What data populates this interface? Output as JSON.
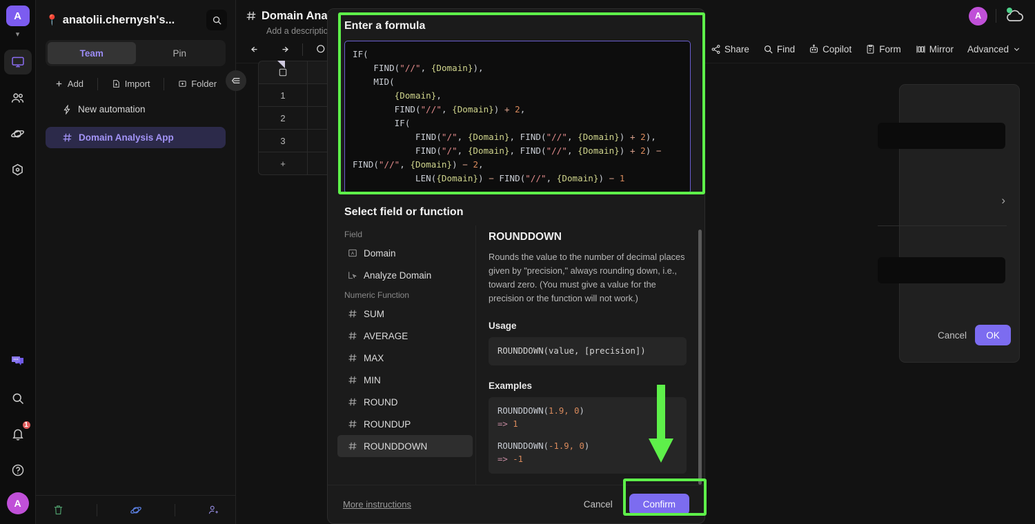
{
  "rail": {
    "logo": "A",
    "avatar": "A",
    "items": [
      {
        "name": "monitor-icon",
        "label": "Workspace"
      },
      {
        "name": "people-icon",
        "label": "Members"
      },
      {
        "name": "planet-icon",
        "label": "Explore"
      },
      {
        "name": "hexagon-icon",
        "label": "Automations"
      },
      {
        "name": "chat-icon",
        "label": "Messages"
      },
      {
        "name": "search-icon",
        "label": "Search"
      },
      {
        "name": "bell-icon",
        "label": "Notifications"
      },
      {
        "name": "help-icon",
        "label": "Help"
      }
    ],
    "notification_count": "1"
  },
  "sidebar": {
    "title": "anatolii.chernysh's...",
    "pin_emoji": "📍",
    "tabs": [
      {
        "label": "Team",
        "active": true
      },
      {
        "label": "Pin",
        "active": false
      }
    ],
    "actions": [
      {
        "label": "Add",
        "icon": "plus-icon"
      },
      {
        "label": "Import",
        "icon": "import-icon"
      },
      {
        "label": "Folder",
        "icon": "folder-plus-icon"
      }
    ],
    "new_automation": "New automation",
    "app_item": "Domain Analysis App",
    "bottom_icons": [
      "trash-icon",
      "planet-icon",
      "add-user-icon"
    ]
  },
  "main": {
    "title": "Domain Analy",
    "description": "Add a description",
    "avatar": "A",
    "toolbar": [
      {
        "label": "Share",
        "icon": "share-icon"
      },
      {
        "label": "Find",
        "icon": "search-icon"
      },
      {
        "label": "Copilot",
        "icon": "robot-icon"
      },
      {
        "label": "Form",
        "icon": "form-icon"
      },
      {
        "label": "Mirror",
        "icon": "mirror-icon"
      },
      {
        "label": "Advanced",
        "icon": "chevron-down-icon"
      }
    ],
    "grid": {
      "rows": [
        "1",
        "2",
        "3"
      ],
      "add_row": "+"
    }
  },
  "background_dialog": {
    "cancel": "Cancel",
    "ok": "OK"
  },
  "modal": {
    "formula_title": "Enter a formula",
    "formula_lines": [
      [
        {
          "t": "IF(",
          "c": "k-fn"
        }
      ],
      [
        {
          "t": "    FIND(",
          "c": "k-fn"
        },
        {
          "t": "\"//\"",
          "c": "k-str"
        },
        {
          "t": ", ",
          "c": "k-fn"
        },
        {
          "t": "{Domain}",
          "c": "k-fld"
        },
        {
          "t": "),",
          "c": "k-fn"
        }
      ],
      [
        {
          "t": "    MID(",
          "c": "k-fn"
        }
      ],
      [
        {
          "t": "        ",
          "c": "k-fn"
        },
        {
          "t": "{Domain}",
          "c": "k-fld"
        },
        {
          "t": ",",
          "c": "k-fn"
        }
      ],
      [
        {
          "t": "        FIND(",
          "c": "k-fn"
        },
        {
          "t": "\"//\"",
          "c": "k-str"
        },
        {
          "t": ", ",
          "c": "k-fn"
        },
        {
          "t": "{Domain}",
          "c": "k-fld"
        },
        {
          "t": ") ",
          "c": "k-fn"
        },
        {
          "t": "+ ",
          "c": "k-op"
        },
        {
          "t": "2",
          "c": "k-num"
        },
        {
          "t": ",",
          "c": "k-fn"
        }
      ],
      [
        {
          "t": "        IF(",
          "c": "k-fn"
        }
      ],
      [
        {
          "t": "            FIND(",
          "c": "k-fn"
        },
        {
          "t": "\"/\"",
          "c": "k-str"
        },
        {
          "t": ", ",
          "c": "k-fn"
        },
        {
          "t": "{Domain}",
          "c": "k-fld"
        },
        {
          "t": ", FIND(",
          "c": "k-fn"
        },
        {
          "t": "\"//\"",
          "c": "k-str"
        },
        {
          "t": ", ",
          "c": "k-fn"
        },
        {
          "t": "{Domain}",
          "c": "k-fld"
        },
        {
          "t": ") ",
          "c": "k-fn"
        },
        {
          "t": "+ ",
          "c": "k-op"
        },
        {
          "t": "2",
          "c": "k-num"
        },
        {
          "t": "),",
          "c": "k-fn"
        }
      ],
      [
        {
          "t": "            FIND(",
          "c": "k-fn"
        },
        {
          "t": "\"/\"",
          "c": "k-str"
        },
        {
          "t": ", ",
          "c": "k-fn"
        },
        {
          "t": "{Domain}",
          "c": "k-fld"
        },
        {
          "t": ", FIND(",
          "c": "k-fn"
        },
        {
          "t": "\"//\"",
          "c": "k-str"
        },
        {
          "t": ", ",
          "c": "k-fn"
        },
        {
          "t": "{Domain}",
          "c": "k-fld"
        },
        {
          "t": ") ",
          "c": "k-fn"
        },
        {
          "t": "+ ",
          "c": "k-op"
        },
        {
          "t": "2",
          "c": "k-num"
        },
        {
          "t": ") ",
          "c": "k-fn"
        },
        {
          "t": "− ",
          "c": "k-op"
        },
        {
          "t": "FIND(",
          "c": "k-fn"
        },
        {
          "t": "\"//\"",
          "c": "k-str"
        },
        {
          "t": ", ",
          "c": "k-fn"
        },
        {
          "t": "{Domain}",
          "c": "k-fld"
        },
        {
          "t": ") ",
          "c": "k-fn"
        },
        {
          "t": "− ",
          "c": "k-op"
        },
        {
          "t": "2",
          "c": "k-num"
        },
        {
          "t": ",",
          "c": "k-fn"
        }
      ],
      [
        {
          "t": "            LEN(",
          "c": "k-fn"
        },
        {
          "t": "{Domain}",
          "c": "k-fld"
        },
        {
          "t": ") ",
          "c": "k-fn"
        },
        {
          "t": "− ",
          "c": "k-op"
        },
        {
          "t": "FIND(",
          "c": "k-fn"
        },
        {
          "t": "\"//\"",
          "c": "k-str"
        },
        {
          "t": ", ",
          "c": "k-fn"
        },
        {
          "t": "{Domain}",
          "c": "k-fld"
        },
        {
          "t": ") ",
          "c": "k-fn"
        },
        {
          "t": "− ",
          "c": "k-op"
        },
        {
          "t": "1",
          "c": "k-num"
        }
      ]
    ],
    "select_title": "Select field or function",
    "group_field": "Field",
    "fields": [
      {
        "label": "Domain",
        "icon": "text-field-icon"
      },
      {
        "label": "Analyze Domain",
        "icon": "button-field-icon"
      }
    ],
    "group_numeric": "Numeric Function",
    "functions": [
      {
        "label": "SUM",
        "icon": "hash-icon",
        "selected": false
      },
      {
        "label": "AVERAGE",
        "icon": "hash-icon",
        "selected": false
      },
      {
        "label": "MAX",
        "icon": "hash-icon",
        "selected": false
      },
      {
        "label": "MIN",
        "icon": "hash-icon",
        "selected": false
      },
      {
        "label": "ROUND",
        "icon": "hash-icon",
        "selected": false
      },
      {
        "label": "ROUNDUP",
        "icon": "hash-icon",
        "selected": false
      },
      {
        "label": "ROUNDDOWN",
        "icon": "hash-icon",
        "selected": true
      }
    ],
    "doc": {
      "name": "ROUNDDOWN",
      "description": "Rounds the value to the number of decimal places given by \"precision,\" always rounding down, i.e., toward zero. (You must give a value for the precision or the function will not work.)",
      "usage_heading": "Usage",
      "usage": "ROUNDDOWN(value, [precision])",
      "examples_heading": "Examples",
      "examples": [
        {
          "call": "ROUNDDOWN(",
          "args": "1.9, 0",
          "close": ")",
          "result_arrow": "=>",
          "result": "1"
        },
        {
          "call": "ROUNDDOWN(",
          "args": "-1.9, 0",
          "close": ")",
          "result_arrow": "=>",
          "result": "-1"
        }
      ]
    },
    "more_instructions": "More instructions",
    "cancel": "Cancel",
    "confirm": "Confirm"
  },
  "annotations": {
    "highlight_color": "#5ef04a",
    "accent_color": "#7c6cf0"
  }
}
